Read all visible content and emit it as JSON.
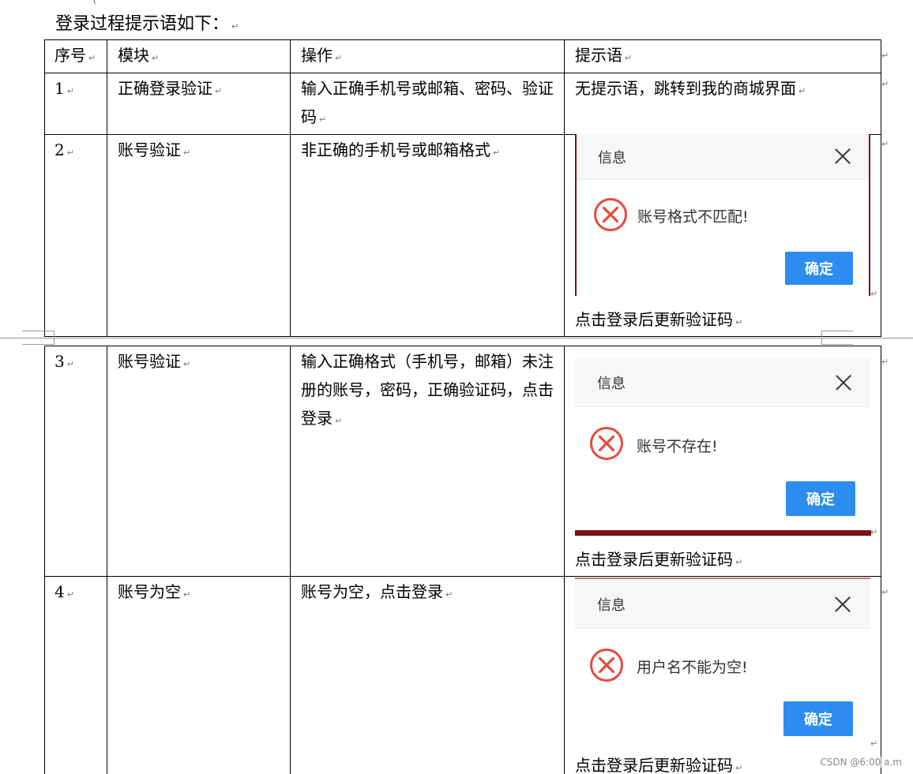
{
  "document": {
    "heading": "登录过程提示语如下：",
    "return_mark": "↵",
    "top_tick": "(",
    "watermark": "CSDN @6:00 a.m"
  },
  "table": {
    "headers": {
      "num": "序号",
      "module": "模块",
      "operation": "操作",
      "prompt": "提示语"
    },
    "rows": [
      {
        "num": "1",
        "module": "正确登录验证",
        "operation": "输入正确手机号或邮箱、密码、验证码",
        "prompt": "无提示语，跳转到我的商城界面"
      },
      {
        "num": "2",
        "module": "账号验证",
        "operation": "非正确的手机号或邮箱格式",
        "after_text": "点击登录后更新验证码",
        "dialog": {
          "title": "信息",
          "message": "账号格式不匹配!",
          "ok_label": "确定"
        }
      },
      {
        "num": "3",
        "module": "账号验证",
        "operation": "输入正确格式（手机号，邮箱）未注册的账号，密码，正确验证码，点击登录",
        "after_text": "点击登录后更新验证码",
        "dialog": {
          "title": "信息",
          "message": "账号不存在!",
          "ok_label": "确定"
        }
      },
      {
        "num": "4",
        "module": "账号为空",
        "operation": "账号为空，点击登录",
        "after_text": "点击登录后更新验证码",
        "dialog": {
          "title": "信息",
          "message": "用户名不能为空!",
          "ok_label": "确定"
        }
      }
    ]
  },
  "colors": {
    "error_red": "#e84a3c",
    "button_blue": "#2d8cf0",
    "dark_red_border": "#7a1010"
  }
}
